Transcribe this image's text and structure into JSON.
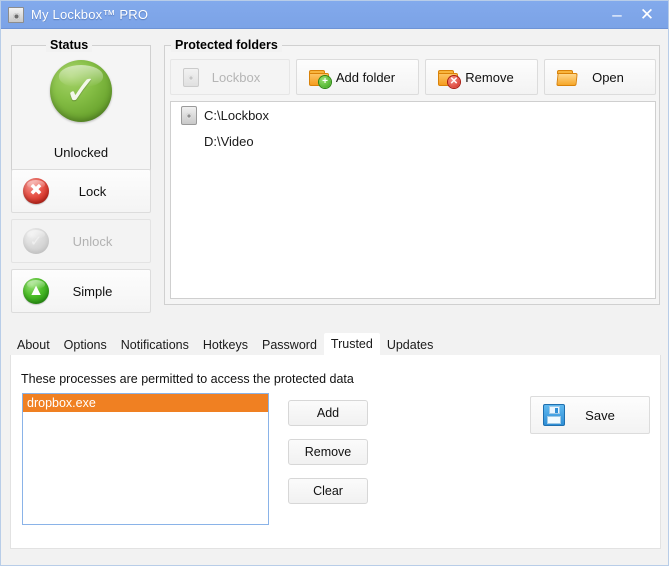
{
  "window": {
    "title": "My Lockbox™ PRO",
    "icon": "lockbox-app-icon",
    "minimize_label": "–",
    "close_label": "✕",
    "titlebar_color": "#7fa6e9"
  },
  "status_panel": {
    "caption": "Status",
    "state_icon": "green-check-circle-icon",
    "state_label": "Unlocked",
    "buttons": [
      {
        "label": "Lock",
        "icon": "red-x-circle-icon",
        "enabled": true,
        "name": "lock-button"
      },
      {
        "label": "Unlock",
        "icon": "grey-check-circle-icon",
        "enabled": false,
        "name": "unlock-button"
      },
      {
        "label": "Simple",
        "icon": "green-up-arrow-circle-icon",
        "enabled": true,
        "name": "simple-button"
      }
    ]
  },
  "protected_folders": {
    "caption": "Protected folders",
    "toolbar": [
      {
        "label": "Lockbox",
        "icon": "lockbox-icon",
        "enabled": false,
        "name": "lockbox-button"
      },
      {
        "label": "Add folder",
        "icon": "folder-add-icon",
        "enabled": true,
        "name": "add-folder-button"
      },
      {
        "label": "Remove",
        "icon": "folder-remove-icon",
        "enabled": true,
        "name": "remove-folder-button"
      },
      {
        "label": "Open",
        "icon": "folder-open-icon",
        "enabled": true,
        "name": "open-folder-button"
      }
    ],
    "items": [
      {
        "path": "C:\\Lockbox",
        "icon": "lockbox-icon",
        "has_icon": true
      },
      {
        "path": "D:\\Video",
        "icon": "",
        "has_icon": false
      }
    ]
  },
  "tabs": {
    "active": "Trusted",
    "items": [
      {
        "label": "About"
      },
      {
        "label": "Options"
      },
      {
        "label": "Notifications"
      },
      {
        "label": "Hotkeys"
      },
      {
        "label": "Password"
      },
      {
        "label": "Trusted"
      },
      {
        "label": "Updates"
      }
    ]
  },
  "trusted_tab": {
    "hint": "These processes are permitted to access the protected data",
    "selection_color": "#f08022",
    "processes": [
      {
        "name": "dropbox.exe",
        "selected": true
      }
    ],
    "buttons": [
      {
        "label": "Add",
        "name": "add-process-button"
      },
      {
        "label": "Remove",
        "name": "remove-process-button"
      },
      {
        "label": "Clear",
        "name": "clear-processes-button"
      }
    ],
    "save": {
      "label": "Save",
      "icon": "floppy-disk-icon"
    }
  }
}
